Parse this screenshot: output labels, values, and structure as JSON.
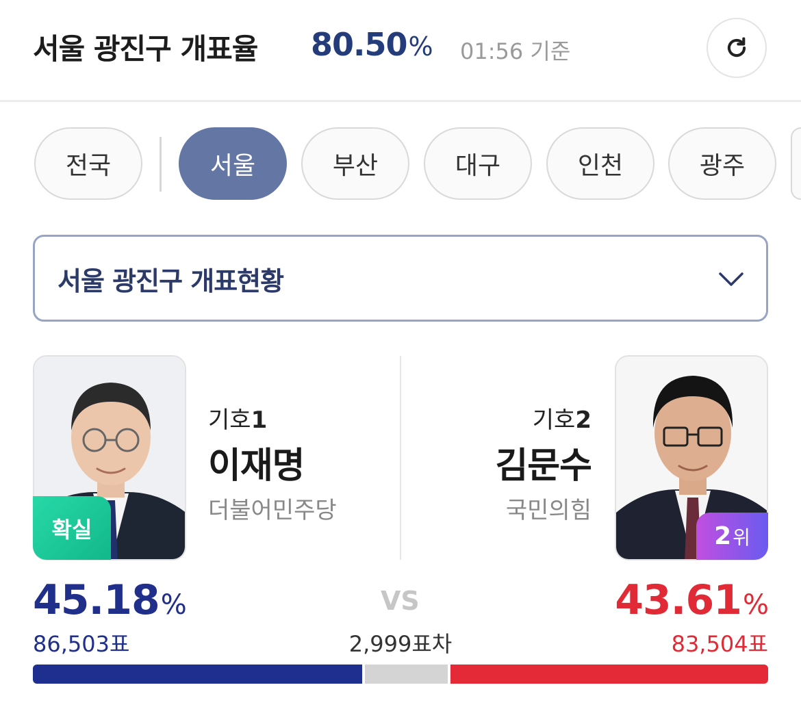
{
  "header": {
    "title": "서울 광진구 개표율",
    "count_rate": "80.50",
    "count_rate_unit": "%",
    "timestamp": "01:56 기준",
    "refresh_icon": "refresh-icon"
  },
  "tabs": [
    {
      "label": "전국",
      "active": false
    },
    {
      "label": "서울",
      "active": true
    },
    {
      "label": "부산",
      "active": false
    },
    {
      "label": "대구",
      "active": false
    },
    {
      "label": "인천",
      "active": false
    },
    {
      "label": "광주",
      "active": false
    }
  ],
  "dropdown": {
    "label": "서울 광진구 개표현황",
    "icon": "chevron-down-icon"
  },
  "candidates": [
    {
      "num_label": "기호",
      "num": "1",
      "name": "이재명",
      "party": "더불어민주당",
      "badge": "확실",
      "percent": "45.18",
      "percent_unit": "%",
      "votes": "86,503표",
      "vote_share": 45.18,
      "color": "#1e2f8f"
    },
    {
      "num_label": "기호",
      "num": "2",
      "name": "김문수",
      "party": "국민의힘",
      "badge_rank": "2",
      "badge_rank_suffix": "위",
      "percent": "43.61",
      "percent_unit": "%",
      "votes": "83,504표",
      "vote_share": 43.61,
      "color": "#e32a36"
    }
  ],
  "comparison": {
    "vs_label": "VS",
    "gap_label": "2,999표차"
  },
  "colors": {
    "accent": "#243d7a",
    "tab_active": "#6477a4",
    "win_badge": "#12b88a",
    "candidate1": "#1e2f8f",
    "candidate2": "#e32a36"
  }
}
